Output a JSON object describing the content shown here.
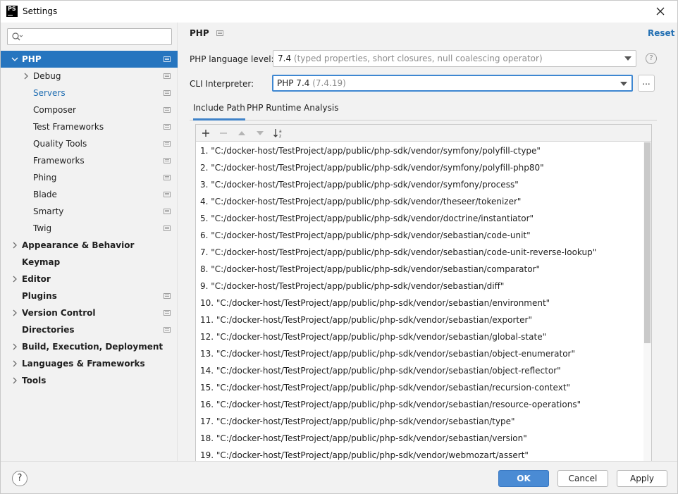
{
  "window": {
    "title": "Settings",
    "app_icon_text": "PS"
  },
  "search": {
    "placeholder": "",
    "value": ""
  },
  "sidebar": {
    "items": [
      {
        "label": "PHP",
        "level": 0,
        "bold": true,
        "expanded": true,
        "selected": true,
        "has_arrow": true,
        "proj_icon": true
      },
      {
        "label": "Debug",
        "level": 1,
        "bold": false,
        "has_arrow": true,
        "proj_icon": true
      },
      {
        "label": "Servers",
        "level": 1,
        "bold": false,
        "link": true,
        "proj_icon": true
      },
      {
        "label": "Composer",
        "level": 1,
        "bold": false,
        "proj_icon": true
      },
      {
        "label": "Test Frameworks",
        "level": 1,
        "bold": false,
        "proj_icon": true
      },
      {
        "label": "Quality Tools",
        "level": 1,
        "bold": false,
        "proj_icon": true
      },
      {
        "label": "Frameworks",
        "level": 1,
        "bold": false,
        "proj_icon": true
      },
      {
        "label": "Phing",
        "level": 1,
        "bold": false,
        "proj_icon": true
      },
      {
        "label": "Blade",
        "level": 1,
        "bold": false,
        "proj_icon": true
      },
      {
        "label": "Smarty",
        "level": 1,
        "bold": false,
        "proj_icon": true
      },
      {
        "label": "Twig",
        "level": 1,
        "bold": false,
        "proj_icon": true
      },
      {
        "label": "Appearance & Behavior",
        "level": 0,
        "bold": true,
        "has_arrow": true
      },
      {
        "label": "Keymap",
        "level": 0,
        "bold": true
      },
      {
        "label": "Editor",
        "level": 0,
        "bold": true,
        "has_arrow": true
      },
      {
        "label": "Plugins",
        "level": 0,
        "bold": true,
        "proj_icon": true
      },
      {
        "label": "Version Control",
        "level": 0,
        "bold": true,
        "has_arrow": true,
        "proj_icon": true
      },
      {
        "label": "Directories",
        "level": 0,
        "bold": true,
        "proj_icon": true
      },
      {
        "label": "Build, Execution, Deployment",
        "level": 0,
        "bold": true,
        "has_arrow": true
      },
      {
        "label": "Languages & Frameworks",
        "level": 0,
        "bold": true,
        "has_arrow": true
      },
      {
        "label": "Tools",
        "level": 0,
        "bold": true,
        "has_arrow": true
      }
    ]
  },
  "main": {
    "title": "PHP",
    "reset_label": "Reset",
    "language_level": {
      "label": "PHP language level:",
      "value": "7.4",
      "detail": "(typed properties, short closures, null coalescing operator)"
    },
    "cli_interpreter": {
      "label": "CLI Interpreter:",
      "value": "PHP 7.4",
      "detail": "(7.4.19)",
      "more_label": "..."
    },
    "help_label": "?",
    "tabs": [
      {
        "label": "Include Path",
        "active": true
      },
      {
        "label": "PHP Runtime",
        "active": false
      },
      {
        "label": "Analysis",
        "active": false
      }
    ],
    "toolbar": {
      "add_icon": "plus-icon",
      "remove_icon": "minus-icon",
      "up_icon": "move-up-icon",
      "down_icon": "move-down-icon",
      "sort_icon": "sort-alphabetically-icon"
    },
    "include_paths": [
      "1. \"C:/docker-host/TestProject/app/public/php-sdk/vendor/symfony/polyfill-ctype\"",
      "2. \"C:/docker-host/TestProject/app/public/php-sdk/vendor/symfony/polyfill-php80\"",
      "3. \"C:/docker-host/TestProject/app/public/php-sdk/vendor/symfony/process\"",
      "4. \"C:/docker-host/TestProject/app/public/php-sdk/vendor/theseer/tokenizer\"",
      "5. \"C:/docker-host/TestProject/app/public/php-sdk/vendor/doctrine/instantiator\"",
      "6. \"C:/docker-host/TestProject/app/public/php-sdk/vendor/sebastian/code-unit\"",
      "7. \"C:/docker-host/TestProject/app/public/php-sdk/vendor/sebastian/code-unit-reverse-lookup\"",
      "8. \"C:/docker-host/TestProject/app/public/php-sdk/vendor/sebastian/comparator\"",
      "9. \"C:/docker-host/TestProject/app/public/php-sdk/vendor/sebastian/diff\"",
      "10. \"C:/docker-host/TestProject/app/public/php-sdk/vendor/sebastian/environment\"",
      "11. \"C:/docker-host/TestProject/app/public/php-sdk/vendor/sebastian/exporter\"",
      "12. \"C:/docker-host/TestProject/app/public/php-sdk/vendor/sebastian/global-state\"",
      "13. \"C:/docker-host/TestProject/app/public/php-sdk/vendor/sebastian/object-enumerator\"",
      "14. \"C:/docker-host/TestProject/app/public/php-sdk/vendor/sebastian/object-reflector\"",
      "15. \"C:/docker-host/TestProject/app/public/php-sdk/vendor/sebastian/recursion-context\"",
      "16. \"C:/docker-host/TestProject/app/public/php-sdk/vendor/sebastian/resource-operations\"",
      "17. \"C:/docker-host/TestProject/app/public/php-sdk/vendor/sebastian/type\"",
      "18. \"C:/docker-host/TestProject/app/public/php-sdk/vendor/sebastian/version\"",
      "19. \"C:/docker-host/TestProject/app/public/php-sdk/vendor/webmozart/assert\""
    ]
  },
  "footer": {
    "help_label": "?",
    "ok_label": "OK",
    "cancel_label": "Cancel",
    "apply_label": "Apply"
  },
  "colors": {
    "selection": "#2675bf",
    "link": "#2470b3",
    "primary_button": "#4a8bd4",
    "focus_border": "#3e87d1"
  }
}
